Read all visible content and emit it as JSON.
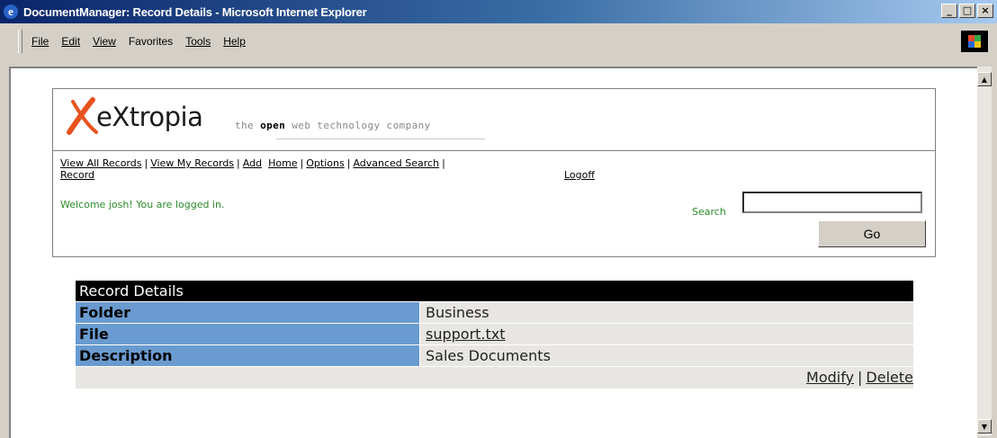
{
  "window": {
    "title": "DocumentManager: Record Details - Microsoft Internet Explorer",
    "controls": {
      "minimize": "_",
      "maximize": "□",
      "close": "×"
    }
  },
  "menu": {
    "items": [
      {
        "label": "File"
      },
      {
        "label": "Edit"
      },
      {
        "label": "View"
      },
      {
        "label": "Favorites"
      },
      {
        "label": "Tools"
      },
      {
        "label": "Help"
      }
    ]
  },
  "site": {
    "logo_text": "eXtropia",
    "tagline_before": "the ",
    "tagline_bold": "open",
    "tagline_after": " web technology company"
  },
  "nav": {
    "view_all": "View All Records",
    "view_my": "View My Records",
    "add": "Add",
    "add_second_line": "Record",
    "home": "Home",
    "options": "Options",
    "advanced_search": "Advanced Search",
    "logoff": "Logoff",
    "separator": "|"
  },
  "welcome": "Welcome josh! You are logged in.",
  "search": {
    "label": "Search",
    "value": "",
    "button": "Go"
  },
  "record": {
    "heading": "Record Details",
    "rows": [
      {
        "label": "Folder",
        "value": "Business"
      },
      {
        "label": "File",
        "value": "support.txt"
      },
      {
        "label": "Description",
        "value": "Sales Documents"
      }
    ],
    "actions": {
      "modify": "Modify",
      "delete": "Delete",
      "separator": "|"
    }
  },
  "colors": {
    "title_bar": "#0a246a",
    "label_cell": "#6a9bd0",
    "welcome_text": "#2b8a2b",
    "logo_accent": "#e8521e"
  }
}
